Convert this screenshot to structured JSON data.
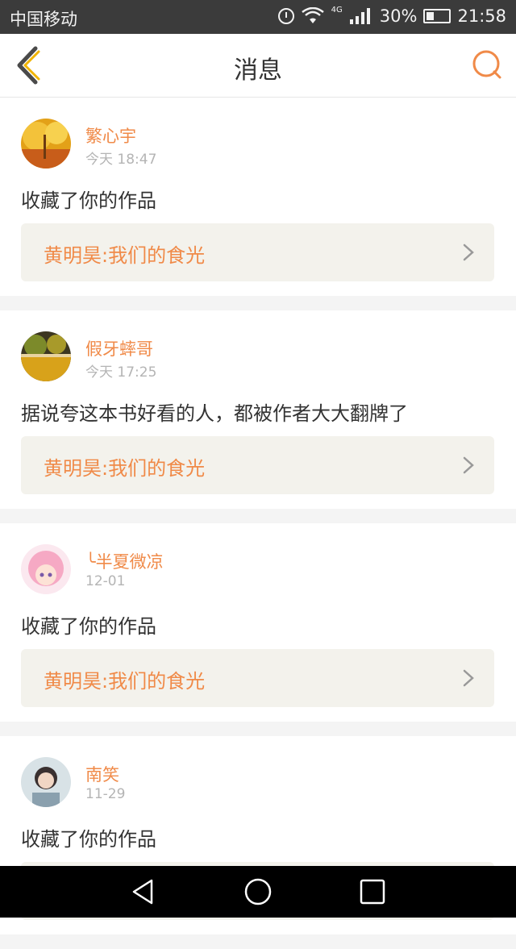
{
  "status_bar": {
    "carrier": "中国移动",
    "network": "4G",
    "battery": "30%",
    "time": "21:58"
  },
  "header": {
    "title": "消息",
    "back_icon": "chevron-left-icon",
    "search_icon": "search-icon",
    "accent_color": "#f08a48"
  },
  "messages": [
    {
      "user": "繁心宇",
      "time": "今天 18:47",
      "text": "收藏了你的作品",
      "work": "黄明昊:我们的食光"
    },
    {
      "user": "假牙蟀哥",
      "time": "今天 17:25",
      "text": "据说夸这本书好看的人，都被作者大大翻牌了",
      "work": "黄明昊:我们的食光"
    },
    {
      "user": "╰半夏微凉",
      "time": "12-01",
      "text": "收藏了你的作品",
      "work": "黄明昊:我们的食光"
    },
    {
      "user": "南笑",
      "time": "11-29",
      "text": "收藏了你的作品",
      "work": ""
    }
  ],
  "navigation": {
    "back": "triangle-back-icon",
    "home": "circle-home-icon",
    "recents": "square-recents-icon"
  }
}
